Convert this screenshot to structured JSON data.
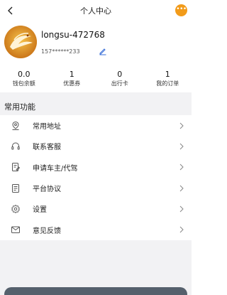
{
  "header": {
    "title": "个人中心"
  },
  "profile": {
    "username": "longsu-472768",
    "phone": "157******233"
  },
  "stats": [
    {
      "value": "0.0",
      "label": "钱包余额"
    },
    {
      "value": "1",
      "label": "优惠券"
    },
    {
      "value": "0",
      "label": "出行卡"
    },
    {
      "value": "1",
      "label": "我的订单"
    }
  ],
  "section": {
    "title": "常用功能"
  },
  "menu": [
    {
      "label": "常用地址",
      "icon": "location-pin-icon"
    },
    {
      "label": "联系客服",
      "icon": "headset-icon"
    },
    {
      "label": "申请车主/代驾",
      "icon": "application-form-icon"
    },
    {
      "label": "平台协议",
      "icon": "document-icon"
    },
    {
      "label": "设置",
      "icon": "gear-icon"
    },
    {
      "label": "意见反馈",
      "icon": "envelope-icon"
    }
  ],
  "colors": {
    "accent": "#f29b1a",
    "background": "#f2f2f4"
  }
}
